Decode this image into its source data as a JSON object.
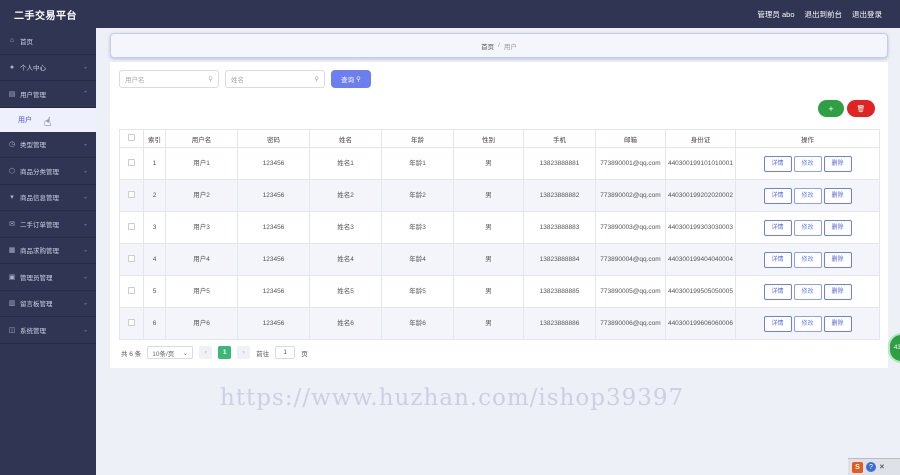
{
  "app": {
    "title": "二手交易平台"
  },
  "topbar": {
    "admin_label": "管理员 abo",
    "back_label": "退出到前台",
    "logout_label": "退出登录"
  },
  "sidebar": {
    "items": [
      {
        "label": "首页",
        "icon": "home-icon",
        "glyph": "⌂",
        "expandable": false
      },
      {
        "label": "个人中心",
        "icon": "user-icon",
        "glyph": "●",
        "expandable": true
      },
      {
        "label": "用户管理",
        "icon": "document-icon",
        "glyph": "▤",
        "expandable": true,
        "expanded": true
      },
      {
        "label": "类型管理",
        "icon": "clock-icon",
        "glyph": "◷",
        "expandable": true
      },
      {
        "label": "商品分类管理",
        "icon": "tag-icon",
        "glyph": "⬡",
        "expandable": true
      },
      {
        "label": "商品信息管理",
        "icon": "trash-icon",
        "glyph": "▾",
        "expandable": true
      },
      {
        "label": "二手订单管理",
        "icon": "mail-icon",
        "glyph": "✉",
        "expandable": true
      },
      {
        "label": "商品求购管理",
        "icon": "grid-icon",
        "glyph": "▦",
        "expandable": true
      },
      {
        "label": "管理员管理",
        "icon": "folder-icon",
        "glyph": "▣",
        "expandable": true
      },
      {
        "label": "留言板管理",
        "icon": "message-icon",
        "glyph": "▥",
        "expandable": true
      },
      {
        "label": "系统管理",
        "icon": "settings-icon",
        "glyph": "◫",
        "expandable": true
      }
    ],
    "submenu": {
      "label": "用户"
    }
  },
  "breadcrumb": {
    "home": "首页",
    "separator": "/",
    "current": "用户"
  },
  "search": {
    "username_placeholder": "用户名",
    "name_placeholder": "姓名",
    "button_label": "查询"
  },
  "actions": {
    "add_glyph": "+",
    "delete_glyph": "🗑"
  },
  "table": {
    "columns": [
      "索引",
      "用户名",
      "密码",
      "姓名",
      "年龄",
      "性别",
      "手机",
      "邮箱",
      "身份证",
      "操作"
    ],
    "op_labels": {
      "detail": "详情",
      "edit": "修改",
      "delete": "删除"
    },
    "rows": [
      {
        "index": "1",
        "username": "用户1",
        "password": "123456",
        "name": "姓名1",
        "age": "年龄1",
        "gender": "男",
        "phone": "13823888881",
        "email": "773890001@qq.com",
        "id_card": "440300199101010001"
      },
      {
        "index": "2",
        "username": "用户2",
        "password": "123456",
        "name": "姓名2",
        "age": "年龄2",
        "gender": "男",
        "phone": "13823888882",
        "email": "773890002@qq.com",
        "id_card": "440300199202020002"
      },
      {
        "index": "3",
        "username": "用户3",
        "password": "123456",
        "name": "姓名3",
        "age": "年龄3",
        "gender": "男",
        "phone": "13823888883",
        "email": "773890003@qq.com",
        "id_card": "440300199303030003"
      },
      {
        "index": "4",
        "username": "用户4",
        "password": "123456",
        "name": "姓名4",
        "age": "年龄4",
        "gender": "男",
        "phone": "13823888884",
        "email": "773890004@qq.com",
        "id_card": "440300199404040004"
      },
      {
        "index": "5",
        "username": "用户5",
        "password": "123456",
        "name": "姓名5",
        "age": "年龄5",
        "gender": "男",
        "phone": "13823888885",
        "email": "773890005@qq.com",
        "id_card": "440300199505050005"
      },
      {
        "index": "6",
        "username": "用户6",
        "password": "123456",
        "name": "姓名6",
        "age": "年龄6",
        "gender": "男",
        "phone": "13823888886",
        "email": "773890006@qq.com",
        "id_card": "440300199606060006"
      }
    ]
  },
  "pager": {
    "total": "共 6 条",
    "page_size": "10条/页",
    "prev": "‹",
    "current_page": "1",
    "next": "›",
    "goto_label": "前往",
    "goto_value": "1",
    "page_suffix": "页"
  },
  "watermark": "https://www.huzhan.com/ishop39397",
  "float_badge": "43",
  "tray": {
    "s": "S",
    "help": "?",
    "close": "✕"
  }
}
